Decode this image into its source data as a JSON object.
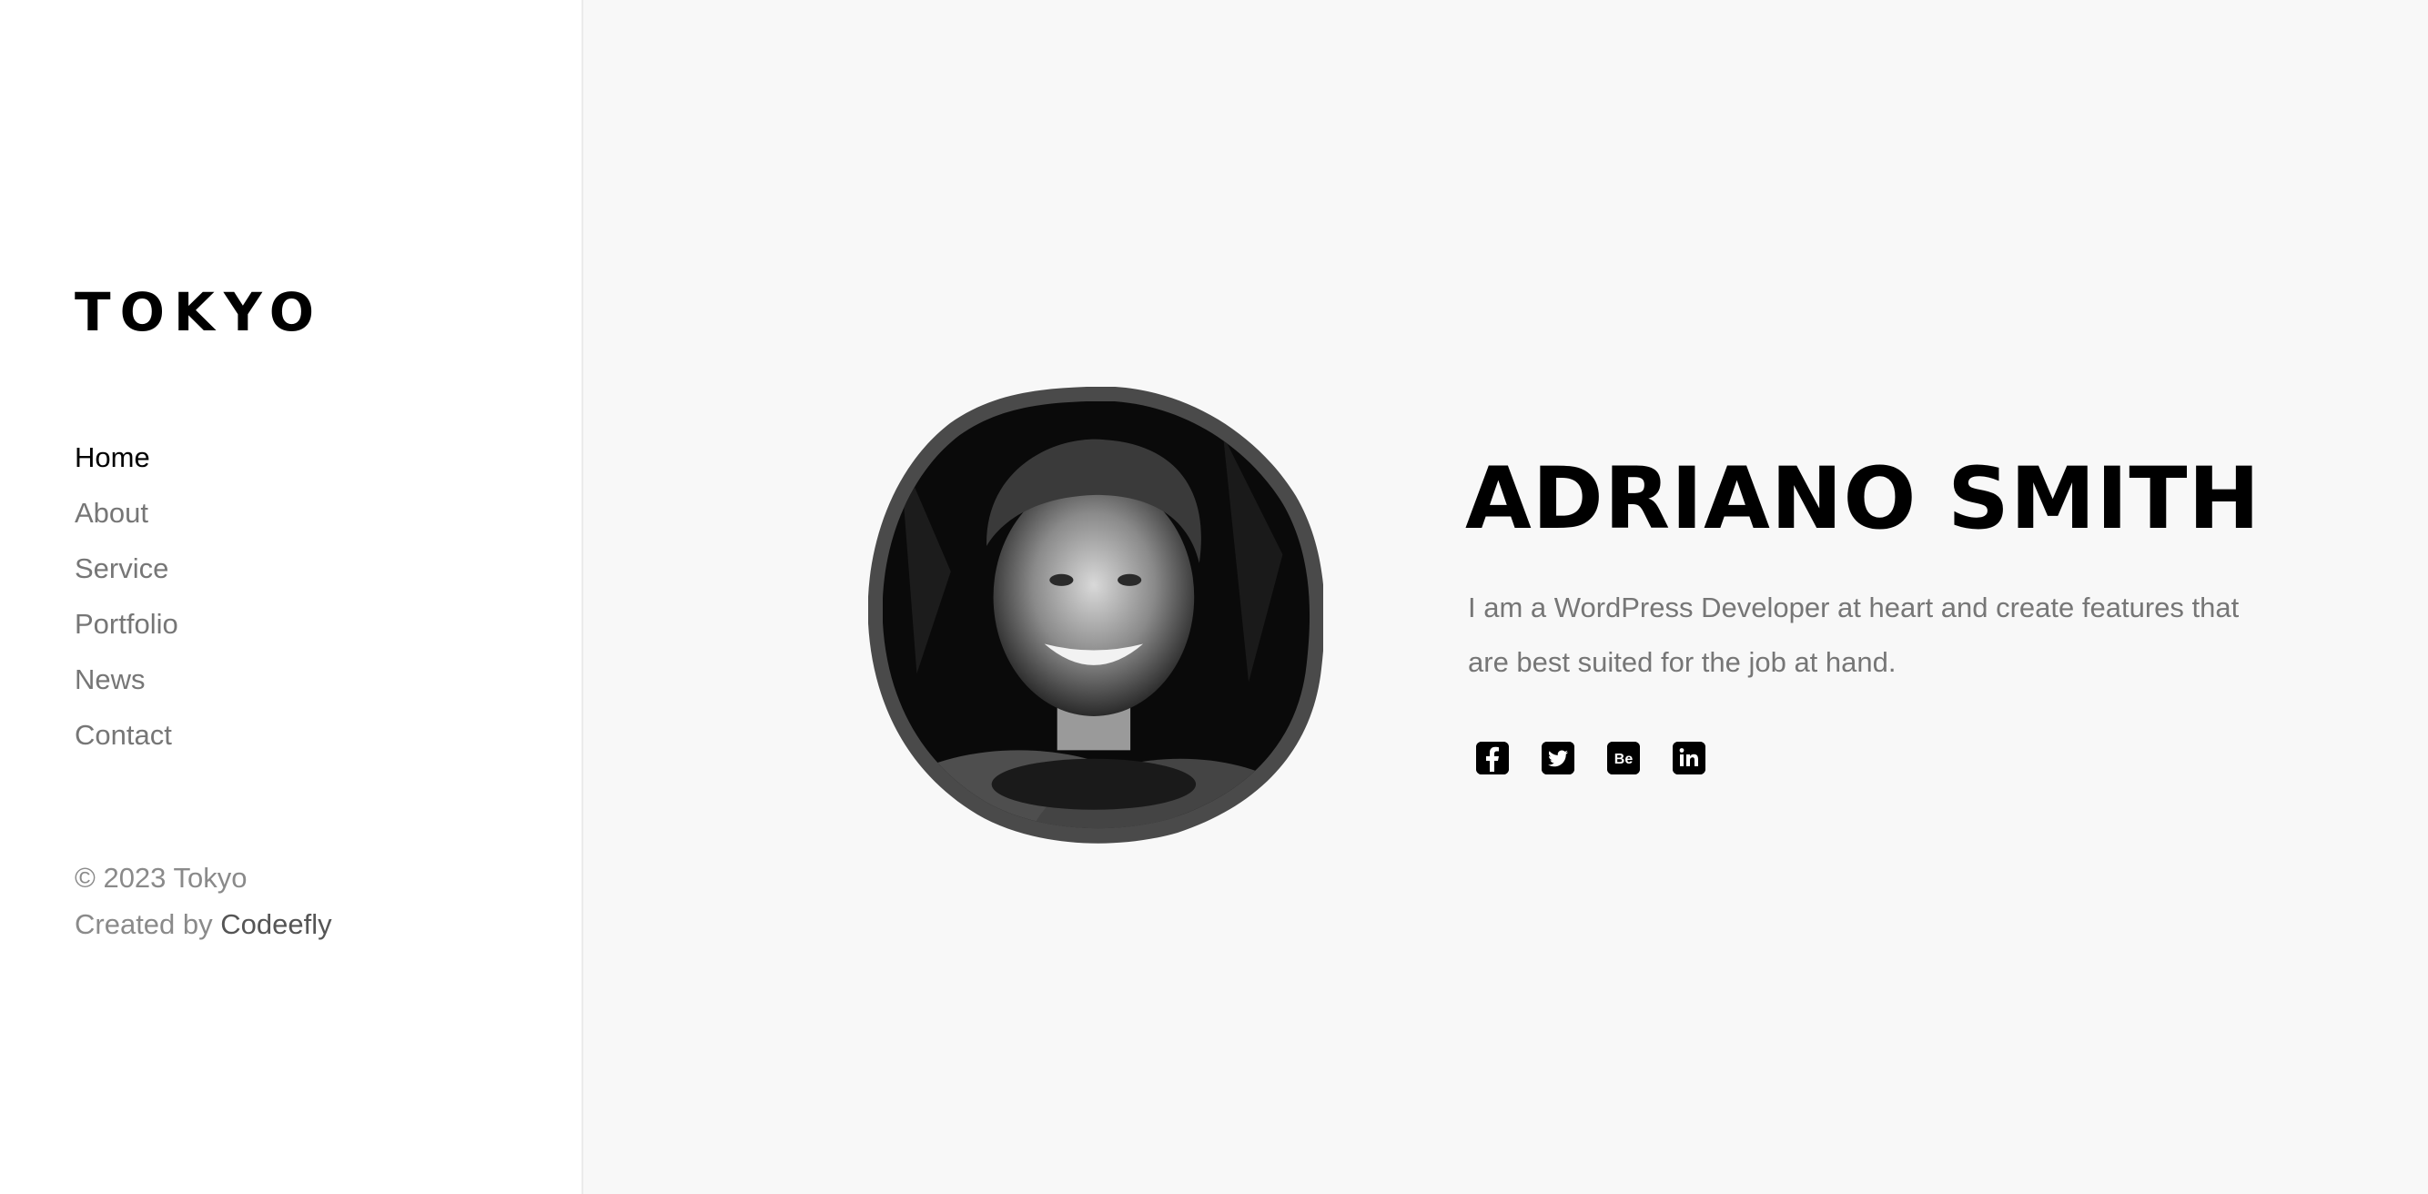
{
  "brand": {
    "logo": "TOKYO"
  },
  "nav": {
    "items": [
      {
        "label": "Home",
        "active": true
      },
      {
        "label": "About",
        "active": false
      },
      {
        "label": "Service",
        "active": false
      },
      {
        "label": "Portfolio",
        "active": false
      },
      {
        "label": "News",
        "active": false
      },
      {
        "label": "Contact",
        "active": false
      }
    ]
  },
  "footer": {
    "copyright": "© 2023 Tokyo",
    "created_by": "Created by",
    "author": "Codeefly"
  },
  "hero": {
    "name": "ADRIANO SMITH",
    "description": "I am a WordPress Developer at heart and create features that are best suited for the job at hand.",
    "avatar_icon": "portrait-photo",
    "socials": [
      {
        "icon": "facebook-icon",
        "glyph": "f"
      },
      {
        "icon": "twitter-icon",
        "glyph": ""
      },
      {
        "icon": "behance-icon",
        "glyph": "Be"
      },
      {
        "icon": "linkedin-icon",
        "glyph": "in"
      }
    ]
  },
  "colors": {
    "sidebar_bg": "#ffffff",
    "main_bg": "#f8f8f8",
    "text_muted": "#767676",
    "text_strong": "#000000"
  }
}
